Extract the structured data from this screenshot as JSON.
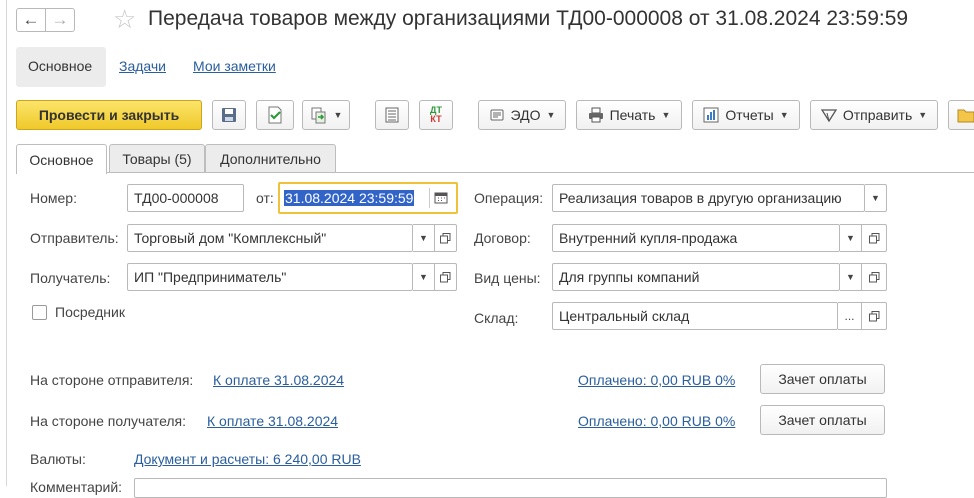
{
  "window": {
    "title": "Передача товаров между организациями ТД00-000008 от 31.08.2024 23:59:59",
    "back_icon": "←",
    "forward_icon": "→",
    "favorite_icon": "☆"
  },
  "panel_tabs": [
    {
      "label": "Основное",
      "active": true
    },
    {
      "label": "Задачи",
      "active": false
    },
    {
      "label": "Мои заметки",
      "active": false
    }
  ],
  "toolbar": {
    "post_and_close": "Провести и закрыть",
    "edo": "ЭДО",
    "print": "Печать",
    "reports": "Отчеты",
    "send": "Отправить",
    "dt_kt_top": "ДТ",
    "dt_kt_bottom": "КТ",
    "accent_color": "#f0c92a"
  },
  "form_tabs": [
    {
      "label": "Основное",
      "active": true
    },
    {
      "label": "Товары (5)",
      "active": false
    },
    {
      "label": "Дополнительно",
      "active": false
    }
  ],
  "fields": {
    "number_label": "Номер:",
    "number_value": "ТД00-000008",
    "date_label": "от:",
    "date_value": "31.08.2024 23:59:59",
    "sender_label": "Отправитель:",
    "sender_value": "Торговый дом \"Комплексный\"",
    "recipient_label": "Получатель:",
    "recipient_value": "ИП \"Предприниматель\"",
    "intermediary_label": "Посредник",
    "intermediary_checked": false,
    "operation_label": "Операция:",
    "operation_value": "Реализация товаров в другую организацию",
    "contract_label": "Договор:",
    "contract_value": "Внутренний купля-продажа",
    "price_type_label": "Вид цены:",
    "price_type_value": "Для группы компаний",
    "warehouse_label": "Склад:",
    "warehouse_value": "Центральный склад",
    "ellipsis": "..."
  },
  "payments": {
    "sender_side_label": "На стороне отправителя:",
    "sender_side_link": "К оплате 31.08.2024",
    "sender_paid_link": "Оплачено: 0,00 RUB 0%",
    "recipient_side_label": "На стороне получателя:",
    "recipient_side_link": "К оплате 31.08.2024",
    "recipient_paid_link": "Оплачено: 0,00 RUB 0%",
    "offset_button": "Зачет оплаты",
    "currency_label": "Валюты:",
    "currency_link": "Документ и расчеты: 6 240,00 RUB",
    "comment_label": "Комментарий:"
  },
  "colors": {
    "link": "#2a5e9c",
    "selection": "#3264c8",
    "date_focus_border": "#f0c23a"
  }
}
